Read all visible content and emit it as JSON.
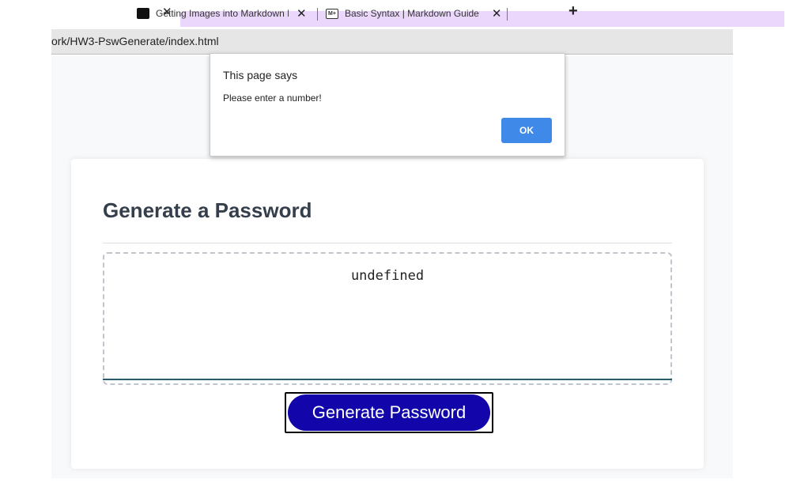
{
  "browser": {
    "tabs": [
      {
        "title": "Getting Images into Markdown D",
        "favicon": "github-icon"
      },
      {
        "title": "Basic Syntax | Markdown Guide",
        "favicon": "markdown-icon",
        "favicon_text": "M+"
      }
    ],
    "close_glyph": "✕",
    "new_tab_glyph": "+",
    "url": "ork/HW3-PswGenerate/index.html",
    "active_tab_color": "#ead7fb"
  },
  "dialog": {
    "title": "This page says",
    "message": "Please enter a number!",
    "ok_label": "OK",
    "ok_color": "#3f8ae8"
  },
  "card": {
    "title": "Generate a Password",
    "password_value": "undefined",
    "generate_label": "Generate Password",
    "button_color": "#1206aa",
    "footer_line_color": "#2a5b6e"
  }
}
